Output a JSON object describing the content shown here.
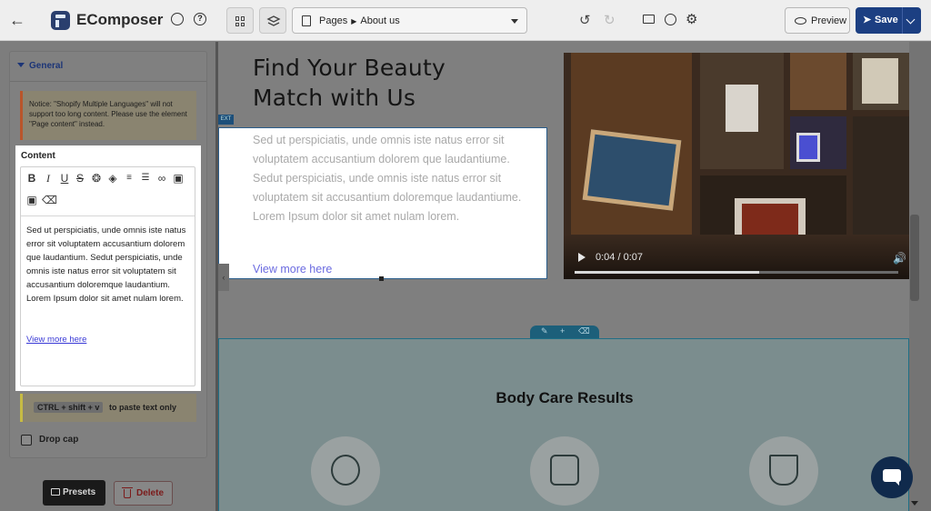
{
  "app": {
    "brand": "EComposer",
    "breadcrumb_root": "Pages",
    "breadcrumb_page": "About us",
    "preview_label": "Preview",
    "save_label": "Save"
  },
  "sidebar": {
    "section_title": "General",
    "notice": "Notice: \"Shopify Multiple Languages\" will not support too long content. Please use the element \"Page content\" instead.",
    "content_label": "Content",
    "editor_text": "Sed ut perspiciatis, unde omnis iste natus error sit voluptatem accusantium dolorem que laudantium. Sedut perspiciatis, unde omnis iste natus error sit voluptatem sit accusantium doloremque laudantium. Lorem Ipsum dolor sit amet nulam lorem.",
    "editor_link": "View more here",
    "shortcut_keys": "CTRL + shift + v",
    "shortcut_text": "to paste text only",
    "dropcap_label": "Drop cap",
    "dropcap_checked": false,
    "presets_label": "Presets",
    "delete_label": "Delete"
  },
  "canvas": {
    "heading": "Find Your Beauty\nMatch with Us",
    "text_tag": "EXT",
    "body_text": "Sed ut perspiciatis, unde omnis iste natus error sit voluptatem accusantium dolorem que laudantiume. Sedut perspiciatis, unde omnis iste natus error sit voluptatem sit accusantium doloremque laudantiume. Lorem Ipsum dolor sit amet nulam lorem.",
    "body_link": "View more here",
    "video": {
      "time": "0:04 / 0:07",
      "progress": 0.57
    },
    "section_title": "Body Care Results"
  },
  "colors": {
    "brand_blue": "#1c3f82",
    "link": "#6b6be0",
    "selection": "#2b5d8a"
  }
}
